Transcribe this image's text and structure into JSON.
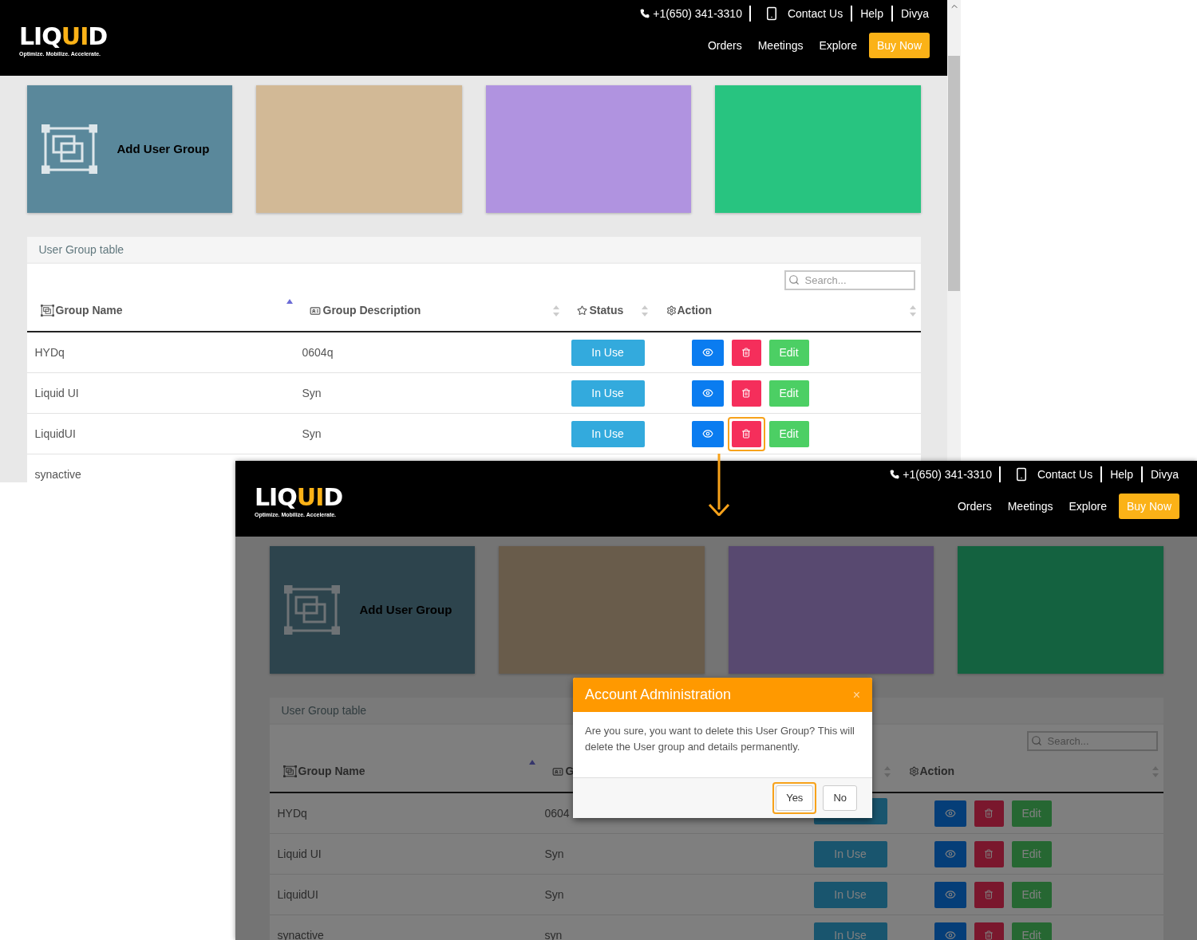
{
  "screens": [
    {
      "dimmed": false,
      "scrollbar": true,
      "header": {
        "logo": {
          "parts": [
            {
              "text": "LIQ",
              "accent": false
            },
            {
              "text": "UI",
              "accent": true
            },
            {
              "text": "D",
              "accent": false
            }
          ],
          "tagline": "Optimize. Mobilize. Accelerate."
        },
        "phone": "+1(650) 341-3310",
        "top_links": [
          {
            "label": "Contact Us",
            "kind": "contact"
          },
          {
            "label": "Help",
            "kind": "plain"
          },
          {
            "label": "Divya",
            "kind": "plain"
          }
        ],
        "nav": [
          "Orders",
          "Meetings",
          "Explore"
        ],
        "cta": "Buy Now"
      },
      "tiles": [
        {
          "color": "#5a889b",
          "kind": "add",
          "label": "Add User Group"
        },
        {
          "color": "#d2b996",
          "kind": "blank"
        },
        {
          "color": "#b093e0",
          "kind": "blank"
        },
        {
          "color": "#28c480",
          "kind": "blank"
        }
      ],
      "table": {
        "title": "User Group table",
        "search_placeholder": "Search...",
        "columns": [
          {
            "label": "Group Name",
            "kind": "group",
            "sorted": true
          },
          {
            "label": "Group Description",
            "kind": "card",
            "sorted": false
          },
          {
            "label": "Status",
            "kind": "star",
            "sorted": false
          },
          {
            "label": "Action",
            "kind": "gear",
            "sorted": false
          }
        ],
        "rows": [
          {
            "name": "HYDq",
            "description": "0604q",
            "status": "In Use",
            "edit": "Edit",
            "delete_highlighted": false
          },
          {
            "name": "Liquid UI",
            "description": "Syn",
            "status": "In Use",
            "edit": "Edit",
            "delete_highlighted": false
          },
          {
            "name": "LiquidUI",
            "description": "Syn",
            "status": "In Use",
            "edit": "Edit",
            "delete_highlighted": true
          },
          {
            "name": "synactive"
          }
        ]
      }
    },
    {
      "dimmed": true,
      "scrollbar": false,
      "header": {
        "logo": {
          "parts": [
            {
              "text": "LIQ",
              "accent": false
            },
            {
              "text": "UI",
              "accent": true
            },
            {
              "text": "D",
              "accent": false
            }
          ],
          "tagline": "Optimize. Mobilize. Accelerate."
        },
        "phone": "+1(650) 341-3310",
        "top_links": [
          {
            "label": "Contact Us",
            "kind": "contact"
          },
          {
            "label": "Help",
            "kind": "plain"
          },
          {
            "label": "Divya",
            "kind": "plain"
          }
        ],
        "nav": [
          "Orders",
          "Meetings",
          "Explore"
        ],
        "cta": "Buy Now"
      },
      "tiles": [
        {
          "color": "#2d444d",
          "kind": "add",
          "label": "Add User Group"
        },
        {
          "color": "#695c4b",
          "kind": "blank"
        },
        {
          "color": "#584970",
          "kind": "blank"
        },
        {
          "color": "#146240",
          "kind": "blank"
        }
      ],
      "table": {
        "title": "User Group table",
        "search_placeholder": "Search...",
        "columns": [
          {
            "label": "Group Name",
            "kind": "group",
            "sorted": true
          },
          {
            "label": "G",
            "kind": "card"
          },
          {
            "kind": "hidden",
            "sorted": false
          },
          {
            "label": "Action",
            "kind": "gear",
            "sorted": false
          }
        ],
        "rows": [
          {
            "name": "HYDq",
            "description": "0604",
            "edit": "Edit",
            "delete_highlighted": false
          },
          {
            "name": "Liquid UI",
            "description": "Syn",
            "status": "In Use",
            "edit": "Edit",
            "delete_highlighted": false
          },
          {
            "name": "LiquidUI",
            "description": "Syn",
            "status": "In Use",
            "edit": "Edit",
            "delete_highlighted": false
          },
          {
            "name": "synactive",
            "description": "syn",
            "status": "In Use",
            "edit": "Edit",
            "delete_highlighted": false
          }
        ]
      },
      "modal": {
        "title": "Account Administration",
        "close": "×",
        "message": "Are you sure, you want to delete this User Group? This will delete the User group and details permanently.",
        "buttons": [
          {
            "label": "Yes",
            "highlighted": true
          },
          {
            "label": "No",
            "highlighted": false
          }
        ]
      }
    }
  ]
}
